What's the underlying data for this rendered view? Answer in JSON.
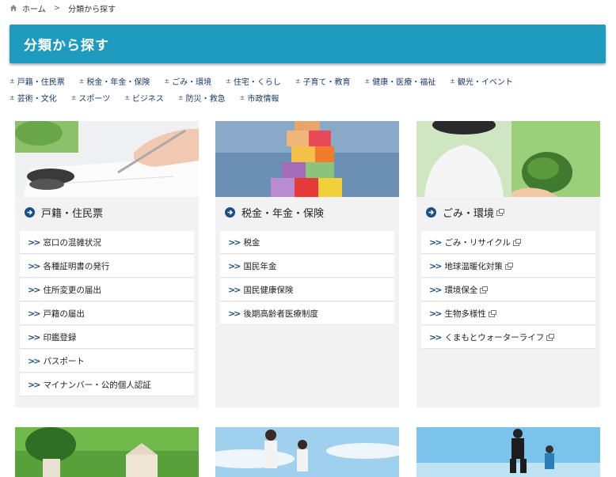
{
  "breadcrumb": {
    "home": "ホーム",
    "separator": ">",
    "current": "分類から探す"
  },
  "page": {
    "title": "分類から探す"
  },
  "categories": {
    "row1": [
      "戸籍・住民票",
      "税金・年金・保険",
      "ごみ・環境",
      "住宅・くらし",
      "子育て・教育",
      "健康・医療・福祉",
      "観光・イベント"
    ],
    "row2": [
      "芸術・文化",
      "スポーツ",
      "ビジネス",
      "防災・救急",
      "市政情報"
    ]
  },
  "cards": [
    {
      "title": "戸籍・住民票",
      "links": [
        "窓口の混雑状況",
        "各種証明書の発行",
        "住所変更の届出",
        "戸籍の届出",
        "印鑑登録",
        "パスポート",
        "マイナンバー・公的個人認証"
      ]
    },
    {
      "title": "税金・年金・保険",
      "links": [
        "税金",
        "国民年金",
        "国民健康保険",
        "後期高齢者医療制度"
      ]
    },
    {
      "title": "ごみ・環境",
      "links": [
        "ごみ・リサイクル",
        "地球温暖化対策",
        "環境保全",
        "生物多様性",
        "くまもとウォーターライフ"
      ]
    }
  ],
  "colors": {
    "header": "#1f9bc0",
    "accent": "#1b4f86"
  }
}
